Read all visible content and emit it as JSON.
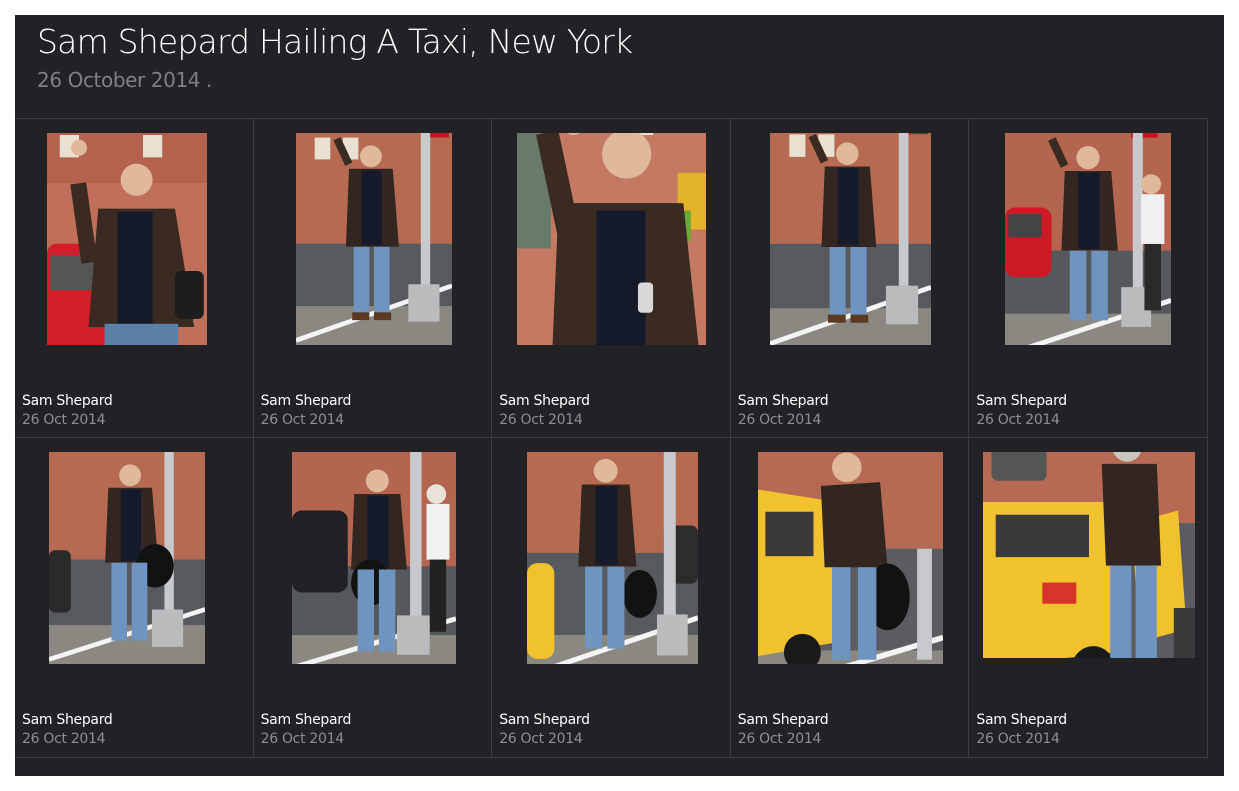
{
  "gallery": {
    "title": "Sam Shepard Hailing A Taxi, New York",
    "date": "26 October 2014 ."
  },
  "photos": [
    {
      "name": "Sam Shepard",
      "date": "26 Oct 2014",
      "scene": "street-closeup"
    },
    {
      "name": "Sam Shepard",
      "date": "26 Oct 2014",
      "scene": "street-pole"
    },
    {
      "name": "Sam Shepard",
      "date": "26 Oct 2014",
      "scene": "closeup-wave"
    },
    {
      "name": "Sam Shepard",
      "date": "26 Oct 2014",
      "scene": "street-pole"
    },
    {
      "name": "Sam Shepard",
      "date": "26 Oct 2014",
      "scene": "street-redcar"
    },
    {
      "name": "Sam Shepard",
      "date": "26 Oct 2014",
      "scene": "street-bag"
    },
    {
      "name": "Sam Shepard",
      "date": "26 Oct 2014",
      "scene": "street-bag-dark"
    },
    {
      "name": "Sam Shepard",
      "date": "26 Oct 2014",
      "scene": "street-taxi-edge"
    },
    {
      "name": "Sam Shepard",
      "date": "26 Oct 2014",
      "scene": "taxi-door"
    },
    {
      "name": "Sam Shepard",
      "date": "26 Oct 2014",
      "scene": "taxi-entering"
    }
  ]
}
